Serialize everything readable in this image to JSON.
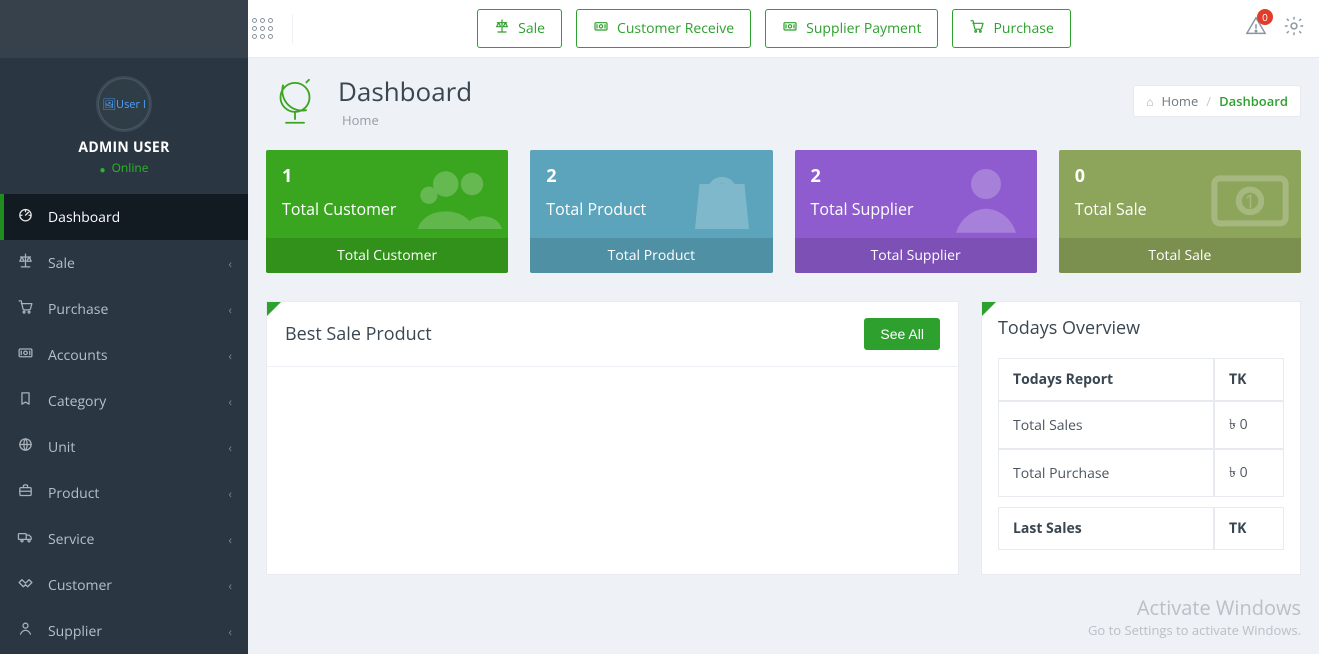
{
  "user": {
    "name": "ADMIN USER",
    "status": "Online",
    "avatarAlt": "User I"
  },
  "sidebar": {
    "items": [
      {
        "label": "Dashboard",
        "name": "dashboard",
        "icon": "dashboard-icon",
        "active": true,
        "expandable": false
      },
      {
        "label": "Sale",
        "name": "sale",
        "icon": "scale-icon",
        "active": false,
        "expandable": true
      },
      {
        "label": "Purchase",
        "name": "purchase",
        "icon": "cart-icon",
        "active": false,
        "expandable": true
      },
      {
        "label": "Accounts",
        "name": "accounts",
        "icon": "money-icon",
        "active": false,
        "expandable": true
      },
      {
        "label": "Category",
        "name": "category",
        "icon": "bookmark-icon",
        "active": false,
        "expandable": true
      },
      {
        "label": "Unit",
        "name": "unit",
        "icon": "globe-icon",
        "active": false,
        "expandable": true
      },
      {
        "label": "Product",
        "name": "product",
        "icon": "briefcase-icon",
        "active": false,
        "expandable": true
      },
      {
        "label": "Service",
        "name": "service",
        "icon": "truck-icon",
        "active": false,
        "expandable": true
      },
      {
        "label": "Customer",
        "name": "customer",
        "icon": "handshake-icon",
        "active": false,
        "expandable": true
      },
      {
        "label": "Supplier",
        "name": "supplier",
        "icon": "person-icon",
        "active": false,
        "expandable": true
      }
    ]
  },
  "topActions": [
    {
      "label": "Sale",
      "name": "sale-action",
      "icon": "scale-icon"
    },
    {
      "label": "Customer Receive",
      "name": "customer-receive-action",
      "icon": "money-icon"
    },
    {
      "label": "Supplier Payment",
      "name": "supplier-payment-action",
      "icon": "money-icon"
    },
    {
      "label": "Purchase",
      "name": "purchase-action",
      "icon": "cart-icon"
    }
  ],
  "notifications": {
    "count": "0"
  },
  "page": {
    "title": "Dashboard",
    "subtitle": "Home"
  },
  "breadcrumbs": {
    "home": "Home",
    "current": "Dashboard"
  },
  "statCards": [
    {
      "value": "1",
      "label": "Total Customer",
      "footer": "Total Customer",
      "color": "green",
      "icon": "users-icon"
    },
    {
      "value": "2",
      "label": "Total Product",
      "footer": "Total Product",
      "color": "teal",
      "icon": "bag-icon"
    },
    {
      "value": "2",
      "label": "Total Supplier",
      "footer": "Total Supplier",
      "color": "purple",
      "icon": "person-icon"
    },
    {
      "value": "0",
      "label": "Total Sale",
      "footer": "Total Sale",
      "color": "olive",
      "icon": "cash-icon"
    }
  ],
  "bestSale": {
    "title": "Best Sale Product",
    "seeAll": "See All"
  },
  "overview": {
    "title": "Todays Overview",
    "report": {
      "head": {
        "c1": "Todays Report",
        "c2": "TK"
      },
      "rows": [
        {
          "label": "Total Sales",
          "value": "৳ 0"
        },
        {
          "label": "Total Purchase",
          "value": "৳ 0"
        }
      ]
    },
    "lastSales": {
      "head": {
        "c1": "Last Sales",
        "c2": "TK"
      }
    }
  },
  "watermark": {
    "l1": "Activate Windows",
    "l2": "Go to Settings to activate Windows."
  }
}
